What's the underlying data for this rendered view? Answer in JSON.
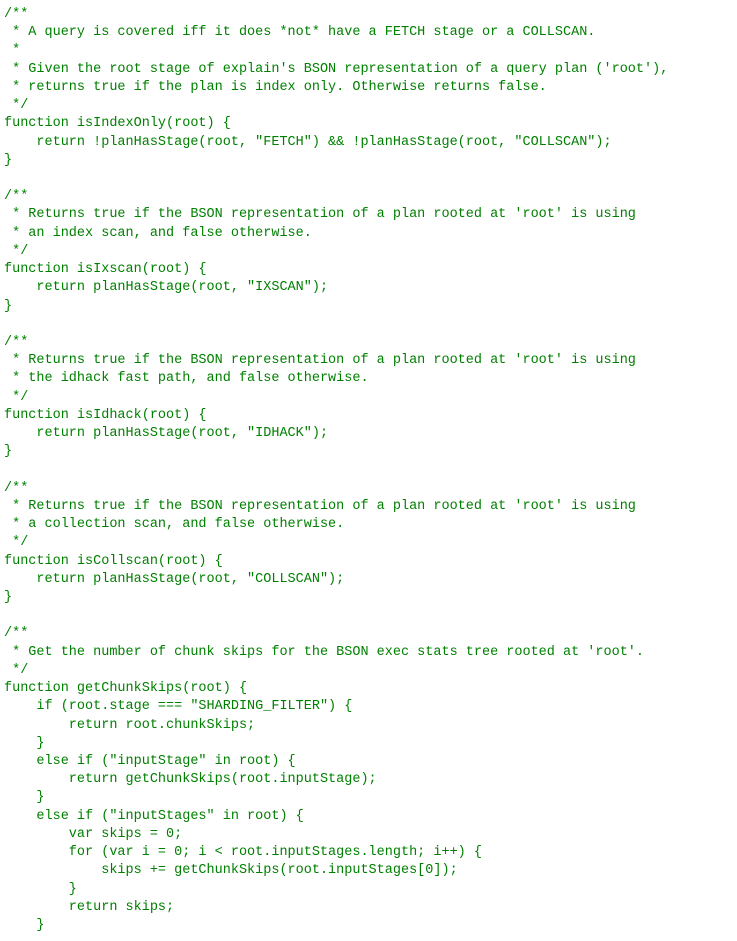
{
  "code_text": "/**\n * A query is covered iff it does *not* have a FETCH stage or a COLLSCAN.\n *\n * Given the root stage of explain's BSON representation of a query plan ('root'),\n * returns true if the plan is index only. Otherwise returns false.\n */\nfunction isIndexOnly(root) {\n    return !planHasStage(root, \"FETCH\") && !planHasStage(root, \"COLLSCAN\");\n}\n\n/**\n * Returns true if the BSON representation of a plan rooted at 'root' is using\n * an index scan, and false otherwise.\n */\nfunction isIxscan(root) {\n    return planHasStage(root, \"IXSCAN\");\n}\n\n/**\n * Returns true if the BSON representation of a plan rooted at 'root' is using\n * the idhack fast path, and false otherwise.\n */\nfunction isIdhack(root) {\n    return planHasStage(root, \"IDHACK\");\n}\n\n/**\n * Returns true if the BSON representation of a plan rooted at 'root' is using\n * a collection scan, and false otherwise.\n */\nfunction isCollscan(root) {\n    return planHasStage(root, \"COLLSCAN\");\n}\n\n/**\n * Get the number of chunk skips for the BSON exec stats tree rooted at 'root'.\n */\nfunction getChunkSkips(root) {\n    if (root.stage === \"SHARDING_FILTER\") {\n        return root.chunkSkips;\n    }\n    else if (\"inputStage\" in root) {\n        return getChunkSkips(root.inputStage);\n    }\n    else if (\"inputStages\" in root) {\n        var skips = 0;\n        for (var i = 0; i < root.inputStages.length; i++) {\n            skips += getChunkSkips(root.inputStages[0]);\n        }\n        return skips;\n    }"
}
